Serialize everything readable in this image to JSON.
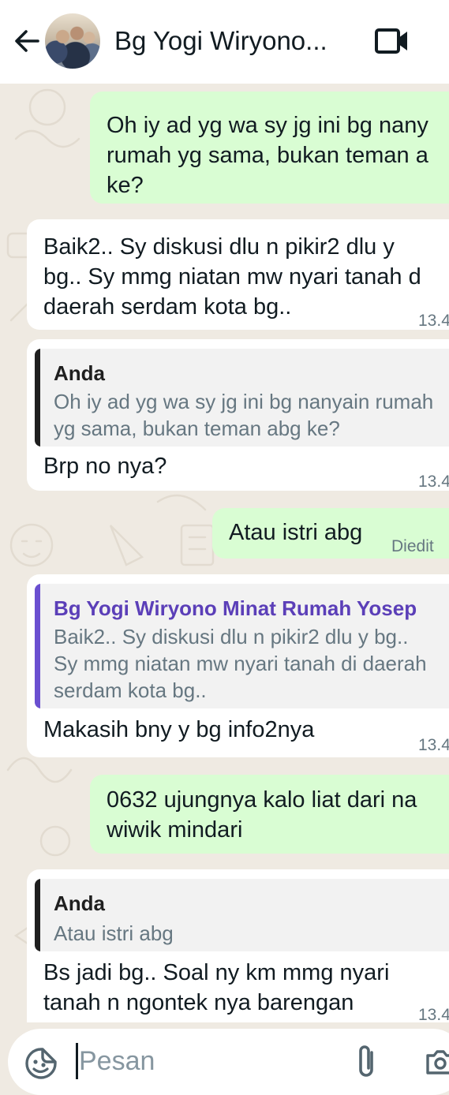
{
  "header": {
    "contact_name": "Bg Yogi Wiryono...",
    "icons": [
      "back-arrow-icon",
      "avatar",
      "video-call-icon"
    ]
  },
  "messages": [
    {
      "direction": "outgoing",
      "lines": [
        "Oh iy ad yg wa sy jg ini bg nany",
        "rumah yg sama, bukan teman a",
        "ke?"
      ]
    },
    {
      "direction": "incoming",
      "lines": [
        "Baik2.. Sy diskusi dlu n pikir2 dlu y",
        "bg.. Sy mmg niatan mw nyari tanah d",
        "daerah serdam kota bg.."
      ],
      "time": "13.4"
    },
    {
      "direction": "incoming",
      "quote": {
        "author": "Anda",
        "lines": [
          "Oh iy ad yg wa sy jg ini bg nanyain rumah",
          "yg sama, bukan teman abg ke?"
        ]
      },
      "lines": [
        "Brp no nya?"
      ],
      "time": "13.4"
    },
    {
      "direction": "outgoing",
      "lines": [
        "Atau istri abg"
      ],
      "status": "Diedit"
    },
    {
      "direction": "incoming",
      "quote": {
        "author": "Bg Yogi Wiryono Minat Rumah Yosep",
        "lines": [
          "Baik2.. Sy diskusi dlu n pikir2 dlu y bg..",
          "Sy mmg niatan mw nyari tanah di daerah",
          "serdam kota bg.."
        ]
      },
      "lines": [
        "Makasih bny y bg info2nya"
      ],
      "time": "13.4"
    },
    {
      "direction": "outgoing",
      "lines": [
        "0632 ujungnya kalo liat dari na",
        "wiwik mindari"
      ]
    },
    {
      "direction": "incoming",
      "quote": {
        "author": "Anda",
        "lines": [
          "Atau istri abg"
        ]
      },
      "lines": [
        "Bs jadi bg.. Soal ny km mmg nyari",
        "tanah n ngontek nya barengan"
      ],
      "time": "13.4"
    }
  ],
  "composer": {
    "placeholder": "Pesan",
    "value": "",
    "icons": [
      "sticker-emoji-icon",
      "attach-paperclip-icon",
      "camera-icon"
    ]
  },
  "colors": {
    "chat_background": "#efeae2",
    "outgoing_bubble": "#d9fdd3",
    "incoming_bubble": "#ffffff",
    "quote_bar_self": "#1f1f1f",
    "quote_bar_contact": "#6a4fd0",
    "quote_author_contact": "#5b3fb8"
  }
}
